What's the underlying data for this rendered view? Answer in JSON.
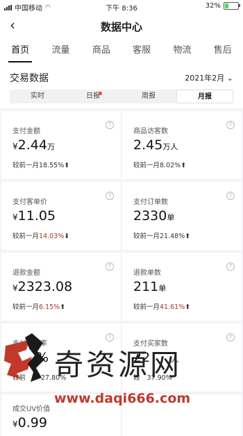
{
  "status": {
    "carrier": "中国移动",
    "time": "下午 8:36",
    "battery": "32%",
    "battery_level": 0.32
  },
  "nav": {
    "title": "数据中心"
  },
  "tabs": [
    {
      "label": "首页"
    },
    {
      "label": "流量"
    },
    {
      "label": "商品"
    },
    {
      "label": "客服"
    },
    {
      "label": "物流"
    },
    {
      "label": "售后"
    }
  ],
  "section": {
    "title": "交易数据",
    "date": "2021年2月"
  },
  "periods": [
    {
      "label": "实时"
    },
    {
      "label": "日报"
    },
    {
      "label": "周报"
    },
    {
      "label": "月报"
    }
  ],
  "metrics": [
    {
      "label": "支付金额",
      "prefix": "¥",
      "value": "2.44",
      "unit": "万",
      "compare": "较前一月",
      "pct": "18.55%",
      "arrow": "⬆"
    },
    {
      "label": "商品访客数",
      "prefix": "",
      "value": "2.45",
      "unit": "万人",
      "compare": "较前一月",
      "pct": "8.02%",
      "arrow": "⬆"
    },
    {
      "label": "支付客单价",
      "prefix": "¥",
      "value": "11.05",
      "unit": "",
      "compare": "较前一月",
      "pct": "14.03%",
      "arrow": "⬇"
    },
    {
      "label": "支付订单数",
      "prefix": "",
      "value": "2330",
      "unit": "单",
      "compare": "较前一月",
      "pct": "21.48%",
      "arrow": "⬆"
    },
    {
      "label": "退款金额",
      "prefix": "¥",
      "value": "2323.08",
      "unit": "",
      "compare": "较前一月",
      "pct": "6.15%",
      "arrow": "⬆"
    },
    {
      "label": "退款单数",
      "prefix": "",
      "value": "211",
      "unit": "单",
      "compare": "较前一月",
      "pct": "41.61%",
      "arrow": "⬆"
    },
    {
      "label": "支付转化率",
      "prefix": "",
      "value": "%",
      "unit": "",
      "compare": "较前",
      "pct": "27.80%",
      "arrow": ""
    },
    {
      "label": "支付买家数",
      "prefix": "",
      "value": "22",
      "unit": "人",
      "compare": "较",
      "pct": "37.90%",
      "arrow": ""
    },
    {
      "label": "成交UV价值",
      "prefix": "¥",
      "value": "0.99",
      "unit": "",
      "compare": "",
      "pct": "",
      "arrow": ""
    }
  ],
  "watermark": {
    "text": "奇资源网",
    "url": "www.daqi666.com"
  }
}
